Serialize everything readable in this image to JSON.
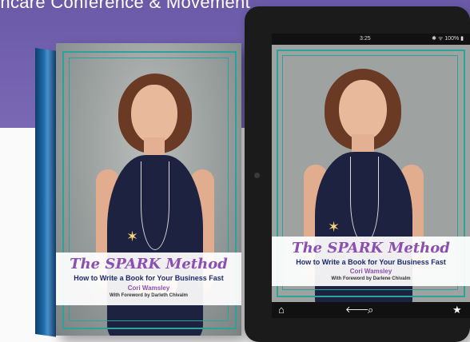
{
  "banner": {
    "text": "thcare Conference & Movement"
  },
  "book": {
    "title": "The SPARK Method",
    "subtitle": "How to Write a Book for Your Business Fast",
    "author": "Cori Wamsley",
    "foreword": "With Foreword by Darleth Chivalm"
  },
  "tablet": {
    "status_time": "3:25",
    "status_icons": "✱ ᯤ 100% ▮",
    "title": "The SPARK Method",
    "subtitle": "How to Write a Book for Your Business Fast",
    "author": "Cori Wamsley",
    "foreword": "With Foreword by Darlene Chivalm",
    "nav": {
      "home_icon": "⌂",
      "back_icon": "🡐",
      "search_icon": "⌕",
      "star_icon": "★"
    }
  },
  "colors": {
    "banner": "#6a5aa8",
    "frame": "#2aa39a",
    "script_title": "#8a4fb0",
    "subtitle": "#1d2b6e"
  }
}
